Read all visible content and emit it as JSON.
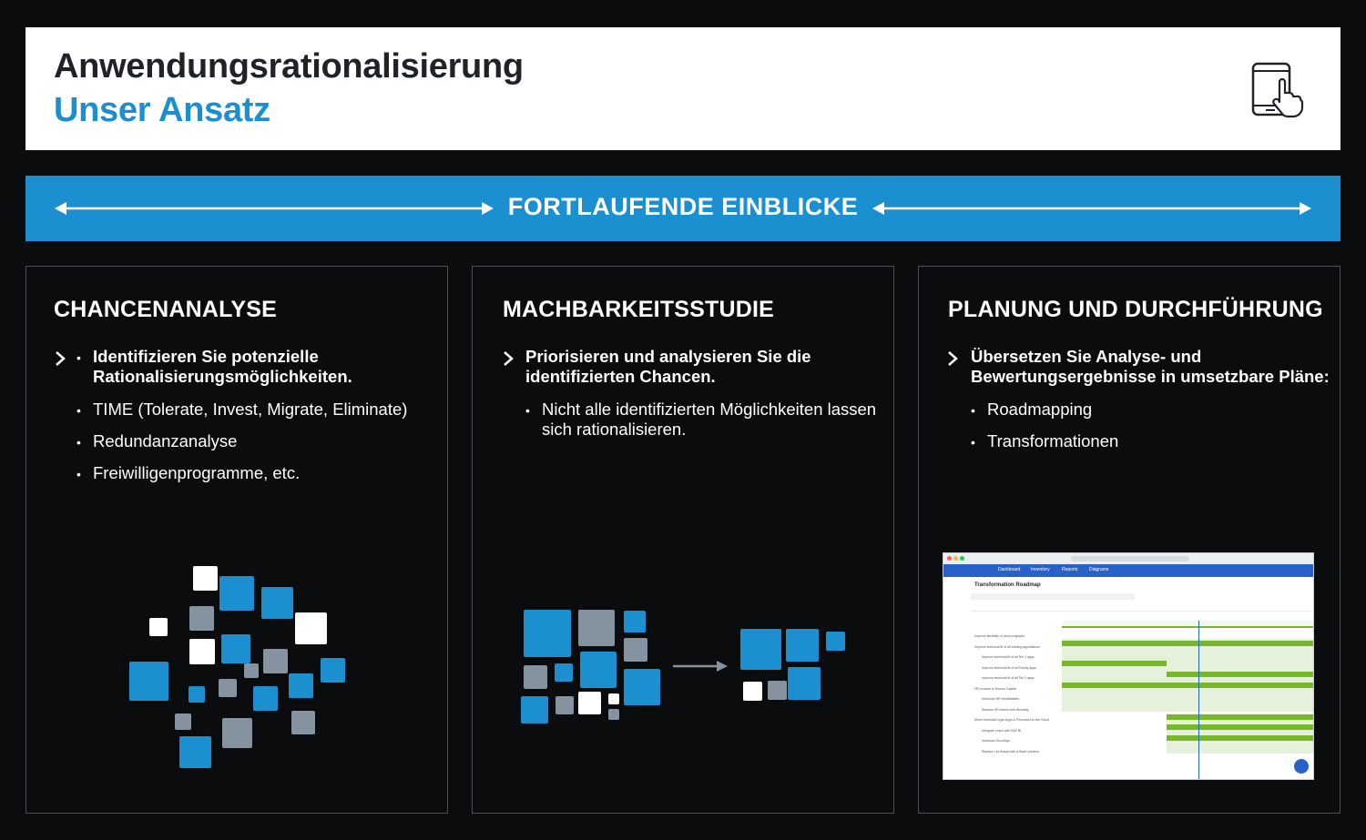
{
  "header": {
    "title": "Anwendungsrationalisierung",
    "subtitle": "Unser Ansatz",
    "icon": "tablet-touch-icon"
  },
  "band": {
    "label": "FORTLAUFENDE EINBLICKE"
  },
  "cards": [
    {
      "title": "CHANCENANALYSE",
      "lead": "Identifizieren Sie potenzielle Rationalisierungsmöglichkeiten.",
      "bullets": [
        "TIME (Tolerate, Invest, Migrate, Eliminate)",
        "Redundanzanalyse",
        "Freiwilligenprogramme, etc."
      ]
    },
    {
      "title": "MACHBARKEITSSTUDIE",
      "lead": "Priorisieren und analysieren Sie die identifizierten Chancen.",
      "bullets": [
        "Nicht alle identifizierten Möglichkeiten lassen sich rationalisieren."
      ]
    },
    {
      "title": "PLANUNG UND DURCHFÜHRUNG",
      "lead": "Übersetzen Sie Analyse- und Bewertungsergebnisse in umsetzbare Pläne:",
      "bullets": [
        "Roadmapping",
        "Transformationen"
      ]
    }
  ],
  "screenshot": {
    "nav": [
      "Dashboard",
      "Inventory",
      "Reports",
      "Diagrams"
    ],
    "page_title": "Transformation Roadmap",
    "rows": [
      "Improve flexibility of cloud migration",
      "Improve technical fit of all existing applications",
      "Improve technical fit of all Tier 1 apps",
      "Improve technical fit of all Priority apps",
      "Improve technical fit of all Tier 2 apps",
      "HR evolves to Human Capital",
      "Introduce HR Healthtables",
      "Replace HR Admin with Workday",
      "Move essential Legal Apps & Processes to the Cloud",
      "Integrate Leanr with SAP BI",
      "Introduce DocuSign",
      "Replace Lex Actual with a SaaS solution"
    ]
  },
  "colors": {
    "accent": "#1b8fd0",
    "gray_square": "#8592a0",
    "background": "#0a0c0e",
    "gantt_green": "#76b82a"
  }
}
